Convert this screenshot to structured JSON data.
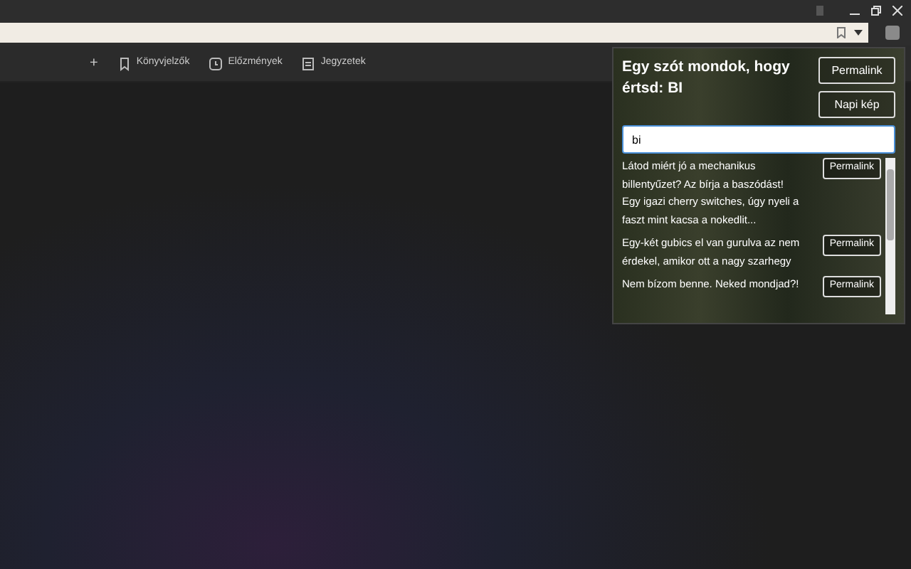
{
  "bookmarks_bar": {
    "add": "+",
    "items": [
      {
        "label": "Könyvjelzők",
        "kind": "bookmark"
      },
      {
        "label": "Előzmények",
        "kind": "history"
      },
      {
        "label": "Jegyzetek",
        "kind": "notes"
      }
    ]
  },
  "popup": {
    "title": "Egy szót mondok, hogy értsd: BI",
    "buttons": [
      "Permalink",
      "Napi kép"
    ],
    "search": {
      "value": "bi"
    },
    "results": [
      {
        "text": "Látod miért jó a mechanikus billentyűzet? Az bírja a baszódást! Egy igazi cherry switches, úgy nyeli a faszt mint kacsa a nokedlit...",
        "button": "Permalink"
      },
      {
        "text": "Egy-két gubics el van gurulva az nem érdekel, amikor ott a nagy szarhegy",
        "button": "Permalink"
      },
      {
        "text": "Nem bízom benne. Neked mondjad?!",
        "button": "Permalink"
      }
    ]
  }
}
